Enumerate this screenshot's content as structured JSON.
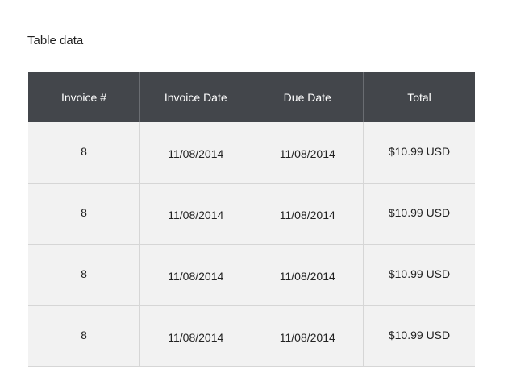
{
  "title": "Table data",
  "table": {
    "headers": [
      "Invoice #",
      "Invoice Date",
      "Due Date",
      "Total"
    ],
    "rows": [
      [
        "8",
        "11/08/2014",
        "11/08/2014",
        "$10.99 USD"
      ],
      [
        "8",
        "11/08/2014",
        "11/08/2014",
        "$10.99 USD"
      ],
      [
        "8",
        "11/08/2014",
        "11/08/2014",
        "$10.99 USD"
      ],
      [
        "8",
        "11/08/2014",
        "11/08/2014",
        "$10.99 USD"
      ]
    ]
  },
  "colors": {
    "header_bg": "#43464b",
    "row_bg": "#f2f2f2",
    "border": "#d6d6d6"
  }
}
